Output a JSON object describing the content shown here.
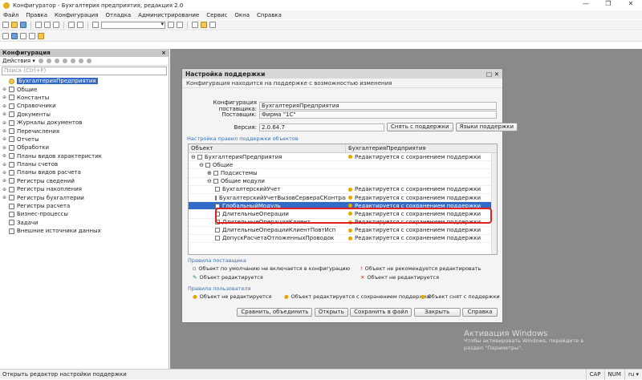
{
  "window": {
    "title": "Конфигуратор - Бухгалтерия предприятия, редакция 2.0",
    "controls": [
      "—",
      "❐",
      "✕"
    ]
  },
  "menu": [
    "Файл",
    "Правка",
    "Конфигурация",
    "Отладка",
    "Администрирование",
    "Сервис",
    "Окна",
    "Справка"
  ],
  "left": {
    "title": "Конфигурация",
    "close": "×",
    "actions": "Действия ▾",
    "search_placeholder": "Поиск (Ctrl+F)",
    "tree": [
      {
        "label": "БухгалтерияПредприятия",
        "root": true,
        "sel": true
      },
      {
        "label": "Общие",
        "pm": "⊕"
      },
      {
        "label": "Константы",
        "pm": "⊕"
      },
      {
        "label": "Справочники",
        "pm": "⊕"
      },
      {
        "label": "Документы",
        "pm": "⊕"
      },
      {
        "label": "Журналы документов",
        "pm": "⊕"
      },
      {
        "label": "Перечисления",
        "pm": "⊕"
      },
      {
        "label": "Отчеты",
        "pm": "⊕"
      },
      {
        "label": "Обработки",
        "pm": "⊕"
      },
      {
        "label": "Планы видов характеристик",
        "pm": "⊕"
      },
      {
        "label": "Планы счетов",
        "pm": "⊕"
      },
      {
        "label": "Планы видов расчета",
        "pm": "⊕"
      },
      {
        "label": "Регистры сведений",
        "pm": "⊕"
      },
      {
        "label": "Регистры накопления",
        "pm": "⊕"
      },
      {
        "label": "Регистры бухгалтерии",
        "pm": "⊕"
      },
      {
        "label": "Регистры расчета",
        "pm": ""
      },
      {
        "label": "Бизнес-процессы",
        "pm": ""
      },
      {
        "label": "Задачи",
        "pm": ""
      },
      {
        "label": "Внешние источники данных",
        "pm": ""
      }
    ]
  },
  "dialog": {
    "title": "Настройка поддержки",
    "close": "□ ✕",
    "info": "Конфигурация находится на поддержке с возможностью изменения",
    "vendor_config_label": "Конфигурация поставщика:",
    "vendor_config": "БухгалтерияПредприятия",
    "vendor_label": "Поставщик:",
    "vendor": "Фирма \"1С\"",
    "version_label": "Версия:",
    "version": "2.0.64.7",
    "btn_remove": "Снять с поддержки",
    "btn_lang": "Языки поддержки",
    "group_rules": "Настройка правил поддержки объектов",
    "col_object": "Объект",
    "col_config": "БухгалтерияПредприятия",
    "rows": [
      {
        "obj": "БухгалтерияПредприятия",
        "rule": "Редактируется с сохранением поддержки",
        "lvl": 0,
        "pm": "⊖"
      },
      {
        "obj": "Общие",
        "rule": "",
        "lvl": 1,
        "pm": "⊖"
      },
      {
        "obj": "Подсистемы",
        "rule": "",
        "lvl": 2,
        "pm": "⊕"
      },
      {
        "obj": "Общие модули",
        "rule": "",
        "lvl": 2,
        "pm": "⊖"
      },
      {
        "obj": "БухгалтерскийУчет",
        "rule": "Редактируется с сохранением поддержки",
        "lvl": 3
      },
      {
        "obj": "БухгалтерскийУчетВызовСервераСКонтрагентами",
        "rule": "Редактируется с сохранением поддержки",
        "lvl": 3
      },
      {
        "obj": "ГлобальныйМодуль",
        "rule": "Редактируется с сохранением поддержки",
        "lvl": 3,
        "hl": true
      },
      {
        "obj": "ДлительныеОперации",
        "rule": "Редактируется с сохранением поддержки",
        "lvl": 3
      },
      {
        "obj": "ДлительныеОперацииКлиент",
        "rule": "Редактируется с сохранением поддержки",
        "lvl": 3
      },
      {
        "obj": "ДлительныеОперацииКлиентПовтИсп",
        "rule": "Редактируется с сохранением поддержки",
        "lvl": 3
      },
      {
        "obj": "ДопускРасчетаОтложенныхПроводок",
        "rule": "Редактируется с сохранением поддержки",
        "lvl": 3
      }
    ],
    "vendor_rules_title": "Правила поставщика",
    "vr1": "Объект по умолчанию не включается в конфигурацию",
    "vr2": "Объект не рекомендуется редактировать",
    "vr3": "Объект редактируется",
    "vr4": "Объект не редактируется",
    "user_rules_title": "Правила пользователя",
    "ur1": "Объект не редактируется",
    "ur2": "Объект редактируется с сохранением поддержки",
    "ur3": "Объект снят с поддержки",
    "btn_compare": "Сравнить, объединить",
    "btn_open": "Открыть",
    "btn_save": "Сохранить в файл",
    "btn_close": "Закрыть",
    "btn_help": "Справка"
  },
  "status": {
    "text": "Открыть редактор настройки поддержки",
    "cap": "CAP",
    "num": "NUM",
    "lang": "ru ▾"
  },
  "watermark": {
    "line1": "Активация Windows",
    "line2": "Чтобы активировать Windows, перейдите в",
    "line3": "раздел \"Параметры\"."
  }
}
